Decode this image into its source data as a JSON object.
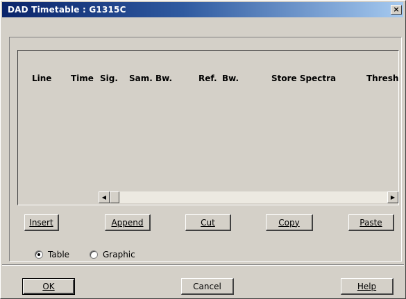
{
  "window": {
    "title": "DAD Timetable : G1315C",
    "close_glyph": "×"
  },
  "table": {
    "columns": [
      "Line",
      "Time",
      "Sig.",
      "Sam. Bw.",
      "Ref.",
      "Bw.",
      "Store Spectra",
      "Thresho"
    ]
  },
  "scrollbar": {
    "left_arrow": "◀",
    "right_arrow": "▶"
  },
  "edit_buttons": {
    "insert": "Insert",
    "append": "Append",
    "cut": "Cut",
    "copy": "Copy",
    "paste": "Paste"
  },
  "view_mode": {
    "options": [
      {
        "label": "Table",
        "selected": true
      },
      {
        "label": "Graphic",
        "selected": false
      }
    ]
  },
  "dialog_buttons": {
    "ok": "OK",
    "cancel": "Cancel",
    "help": "Help"
  }
}
